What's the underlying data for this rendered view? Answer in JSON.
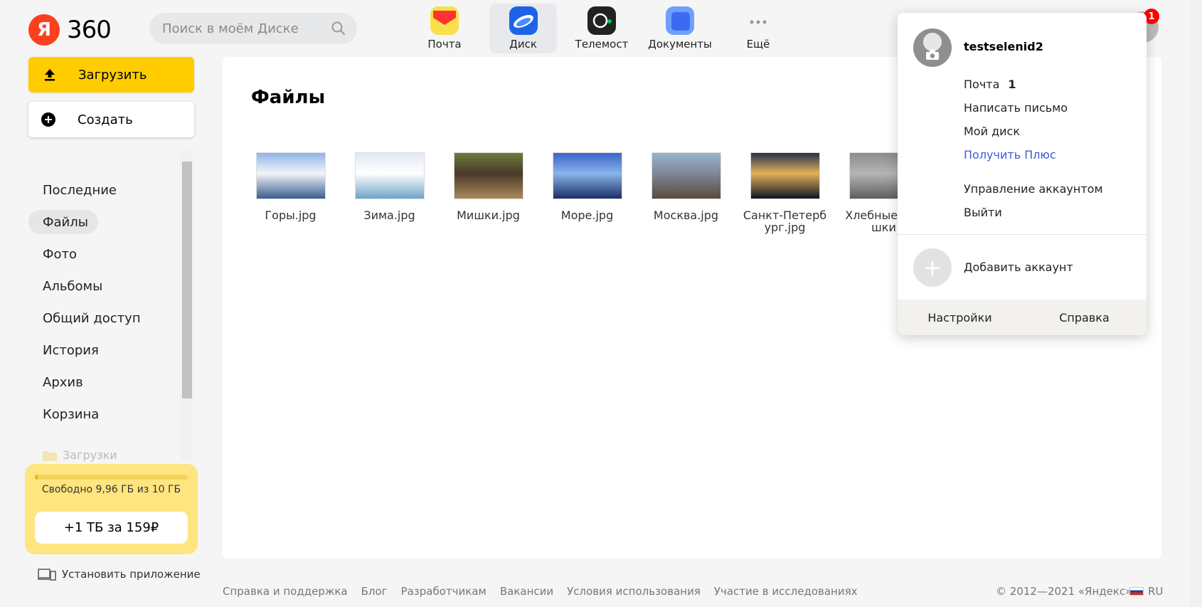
{
  "logo": {
    "letter": "Я",
    "text": "360"
  },
  "search": {
    "placeholder": "Поиск в моём Диске"
  },
  "apps": [
    {
      "label": "Почта",
      "color": "#f8e14b",
      "accent": "#f33"
    },
    {
      "label": "Диск",
      "color": "#1d63e6",
      "active": true
    },
    {
      "label": "Телемост",
      "color": "#222222",
      "accent": "#00c853"
    },
    {
      "label": "Документы",
      "color": "#3d7bff"
    },
    {
      "label": "Ещё",
      "icon": "more-icon"
    }
  ],
  "notifications": {
    "count": "1"
  },
  "sidebar": {
    "upload_label": "Загрузить",
    "create_label": "Создать",
    "items": [
      {
        "label": "Последние"
      },
      {
        "label": "Файлы",
        "active": true
      },
      {
        "label": "Фото"
      },
      {
        "label": "Альбомы"
      },
      {
        "label": "Общий доступ"
      },
      {
        "label": "История"
      },
      {
        "label": "Архив"
      },
      {
        "label": "Корзина"
      }
    ],
    "folder_label": "Загрузки",
    "quota_text": "Свободно 9,96 ГБ из 10 ГБ",
    "quota_used_fraction": 0.004,
    "upgrade_label": "+1 ТБ за 159₽",
    "install_label": "Установить приложение"
  },
  "main": {
    "title": "Файлы",
    "files": [
      {
        "name": "Горы.jpg",
        "colors": [
          "#8fb4e8",
          "#f3f5f8",
          "#3a5c8f"
        ]
      },
      {
        "name": "Зима.jpg",
        "colors": [
          "#dfe9f2",
          "#ffffff",
          "#6fa3c8"
        ]
      },
      {
        "name": "Мишки.jpg",
        "colors": [
          "#6b7d3d",
          "#4a3a28",
          "#a88a5a"
        ]
      },
      {
        "name": "Море.jpg",
        "colors": [
          "#3a64c8",
          "#8ab4ea",
          "#1a2f66"
        ]
      },
      {
        "name": "Москва.jpg",
        "colors": [
          "#9ab4cf",
          "#7f8796",
          "#5a4a3c"
        ]
      },
      {
        "name": "Санкт-Петербург.jpg",
        "colors": [
          "#25324a",
          "#e3b25a",
          "#0e1422"
        ]
      },
      {
        "name": "Хлебные крошки",
        "colors": [
          "#8c8c8c",
          "#b5b5b5",
          "#5e5e5e"
        ]
      }
    ]
  },
  "footer": {
    "links": [
      "Справка и поддержка",
      "Блог",
      "Разработчикам",
      "Вакансии",
      "Условия использования",
      "Участие в исследованиях"
    ],
    "copyright": "© 2012—2021 «Яндекс»",
    "lang": "RU"
  },
  "account_popup": {
    "username": "testselenid2",
    "mail_label": "Почта",
    "mail_count": "1",
    "items": [
      "Написать письмо",
      "Мой диск"
    ],
    "plus_label": "Получить Плюс",
    "items2": [
      "Управление аккаунтом",
      "Выйти"
    ],
    "add_account_label": "Добавить аккаунт",
    "settings_label": "Настройки",
    "help_label": "Справка"
  }
}
